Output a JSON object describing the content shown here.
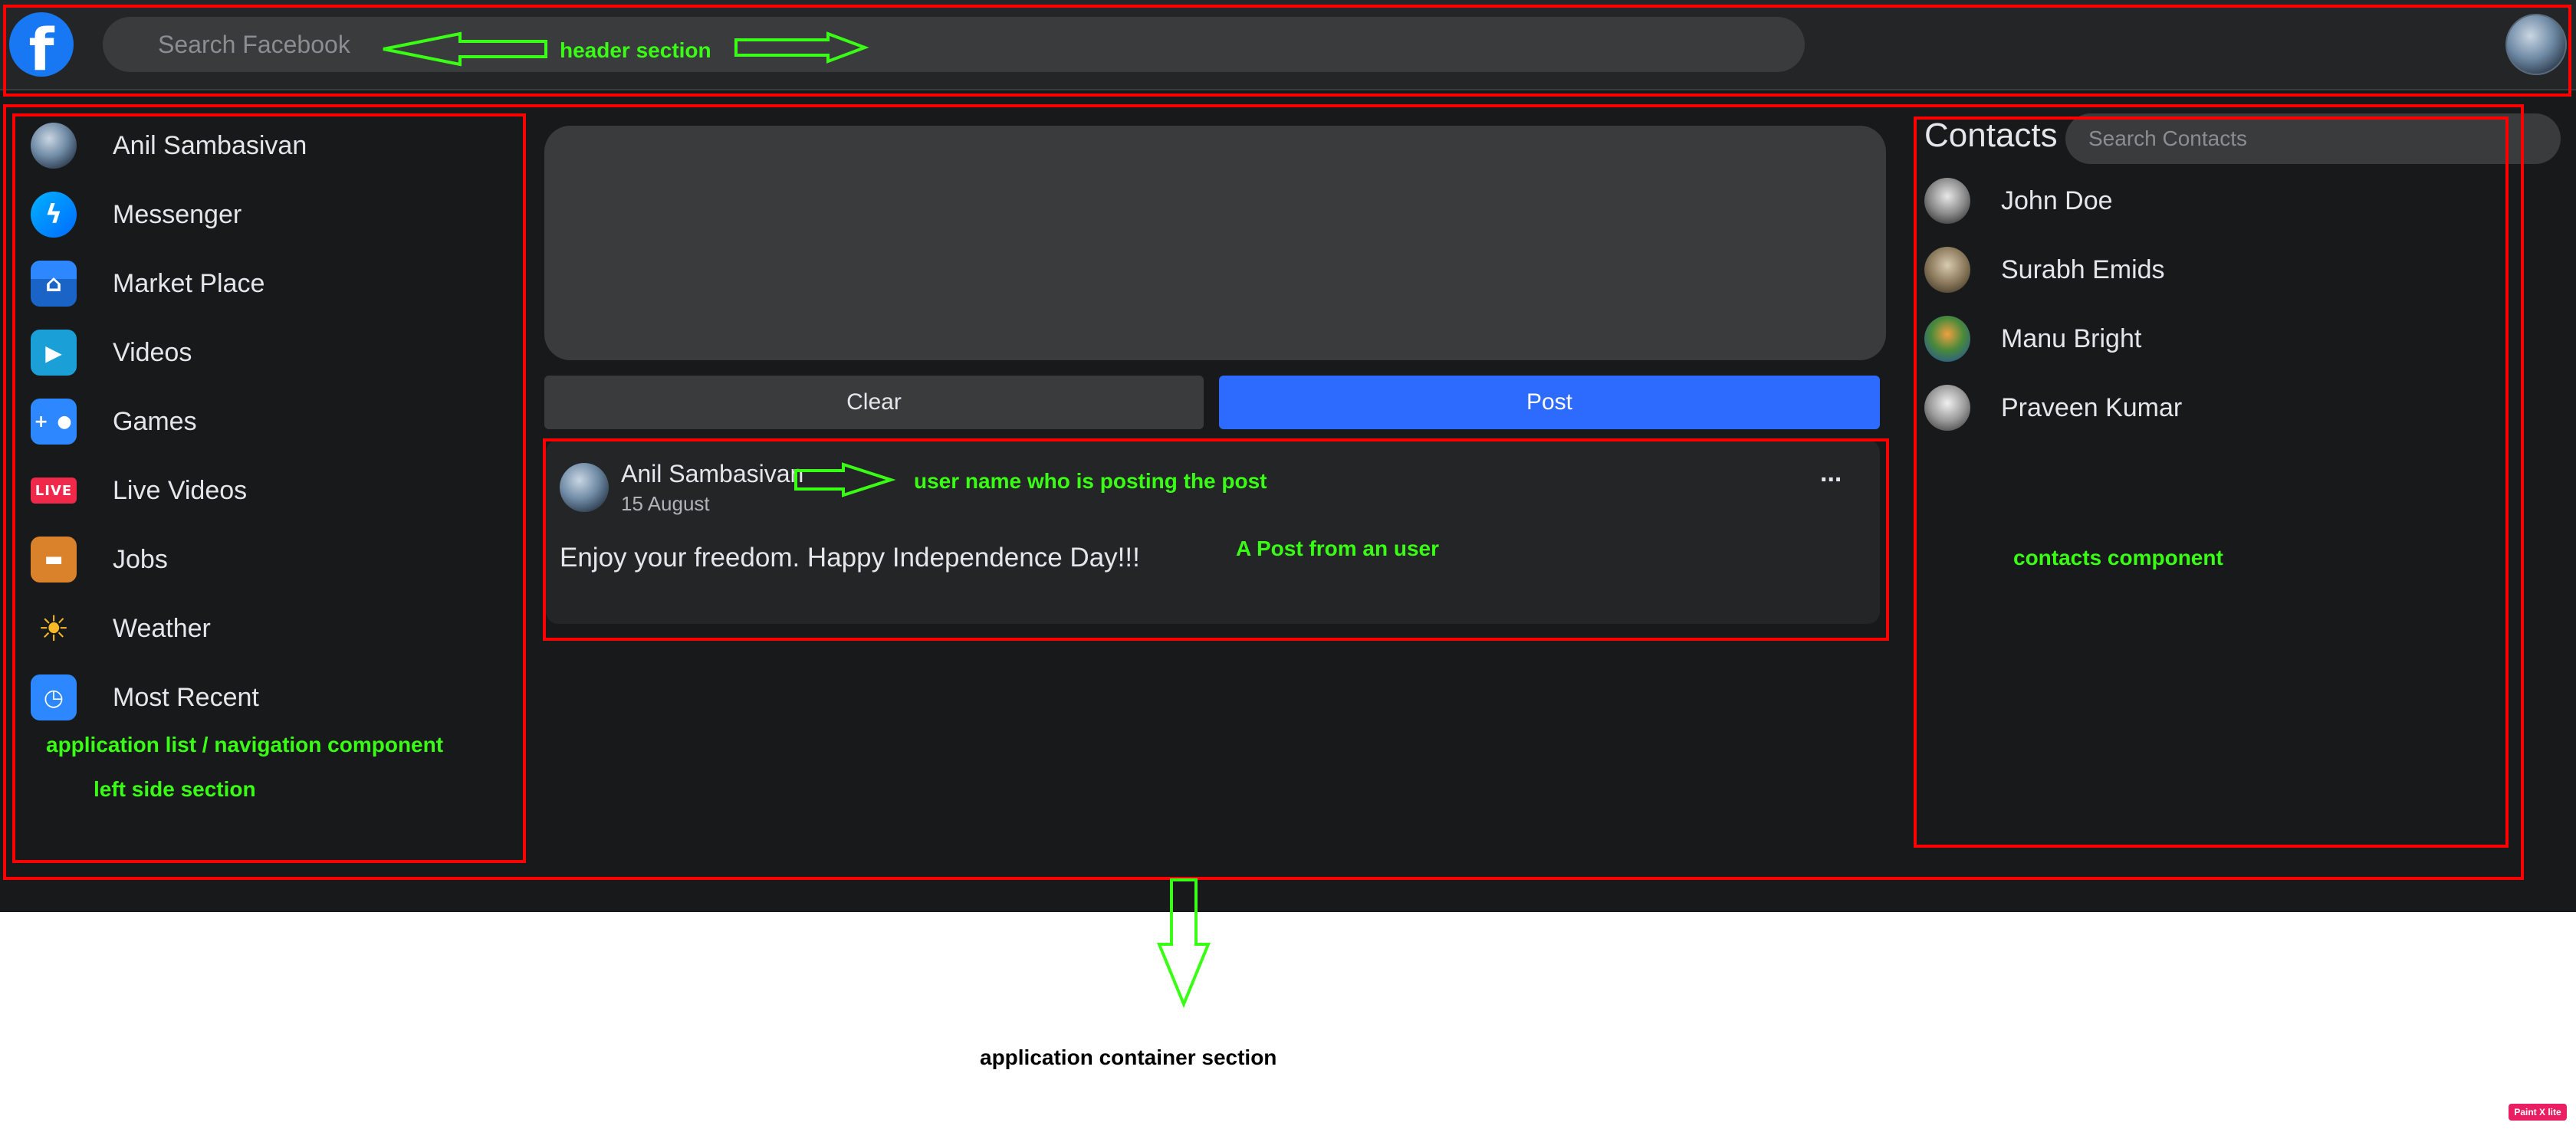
{
  "header": {
    "logo_letter": "f",
    "search_placeholder": "Search Facebook"
  },
  "sidebar": {
    "items": [
      {
        "label": "Anil Sambasivan",
        "icon": "user-avatar-icon",
        "glyph": ""
      },
      {
        "label": "Messenger",
        "icon": "messenger-icon",
        "glyph": "ϟ"
      },
      {
        "label": "Market Place",
        "icon": "marketplace-icon",
        "glyph": "⌂"
      },
      {
        "label": "Videos",
        "icon": "videos-icon",
        "glyph": "▶"
      },
      {
        "label": "Games",
        "icon": "games-icon",
        "glyph": "+ ●"
      },
      {
        "label": "Live Videos",
        "icon": "live-icon",
        "glyph": "LIVE"
      },
      {
        "label": "Jobs",
        "icon": "briefcase-icon",
        "glyph": "▬"
      },
      {
        "label": "Weather",
        "icon": "weather-icon",
        "glyph": "☀"
      },
      {
        "label": "Most Recent",
        "icon": "most-recent-icon",
        "glyph": "◷"
      }
    ]
  },
  "composer": {
    "clear_label": "Clear",
    "post_label": "Post"
  },
  "post": {
    "author": "Anil Sambasivan",
    "date": "15 August",
    "more": "...",
    "body": "Enjoy your freedom. Happy Independence Day!!!"
  },
  "contacts": {
    "title": "Contacts",
    "search_placeholder": "Search Contacts",
    "items": [
      {
        "name": "John Doe"
      },
      {
        "name": "Surabh Emids"
      },
      {
        "name": "Manu Bright"
      },
      {
        "name": "Praveen Kumar"
      }
    ]
  },
  "annotations": {
    "header_section": "header section",
    "user_name_posting": "user name who is posting the post",
    "post_from_user": "A Post from an user",
    "contacts_component": "contacts component",
    "app_list_nav": "application list / navigation component",
    "left_side": "left side section",
    "app_container": "application container section",
    "paint_badge": "Paint X lite"
  },
  "colors": {
    "brand_blue": "#1877f2",
    "post_button": "#2d6bff",
    "annotation_box": "#ff0000",
    "annotation_text": "#39ff14",
    "live_badge": "#f02849"
  }
}
